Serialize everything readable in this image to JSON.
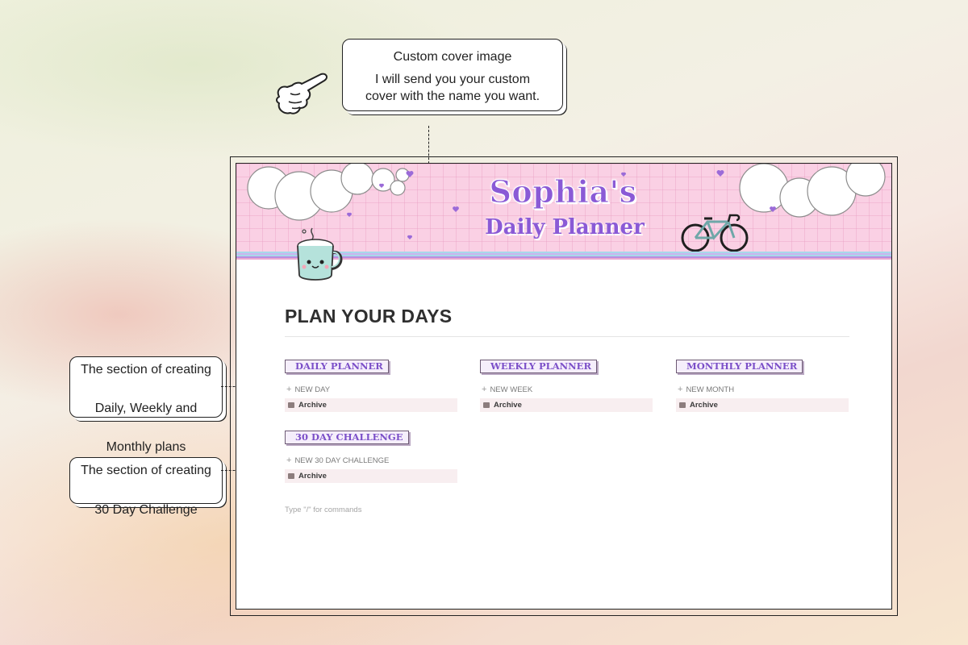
{
  "callouts": {
    "cover": {
      "title": "Custom cover image",
      "body_line1": "I will send you your custom",
      "body_line2": "cover with the name you want."
    },
    "section1": {
      "line1": "The section of creating",
      "line2": "Daily, Weekly and",
      "line3": "Monthly plans"
    },
    "section2": {
      "line1": "The section of creating",
      "line2": "30 Day Challenge"
    }
  },
  "cover": {
    "title_line1": "Sophia's",
    "title_line2": "Daily Planner"
  },
  "page": {
    "heading": "PLAN YOUR DAYS",
    "command_hint": "Type \"/\" for commands"
  },
  "galleries": [
    {
      "tag": "DAILY PLANNER",
      "new_label": "NEW DAY",
      "archive_label": "Archive"
    },
    {
      "tag": "WEEKLY PLANNER",
      "new_label": "NEW WEEK",
      "archive_label": "Archive"
    },
    {
      "tag": "MONTHLY PLANNER",
      "new_label": "NEW MONTH",
      "archive_label": "Archive"
    },
    {
      "tag": "30 DAY CHALLENGE",
      "new_label": "NEW 30 DAY CHALLENGE",
      "archive_label": "Archive"
    }
  ],
  "icons": {
    "pointer": "pointing-hand-icon",
    "mug": "mug-icon",
    "bicycle": "bicycle-icon",
    "clouds": "cloud-icon",
    "hearts": "heart-icon",
    "add": "plus-icon",
    "archive": "archive-icon"
  },
  "colors": {
    "accent_purple": "#8a5ad6",
    "cover_pink": "#fad0e4",
    "stripe_blue": "#a8d8ea",
    "stripe_purple": "#b98ee0"
  }
}
